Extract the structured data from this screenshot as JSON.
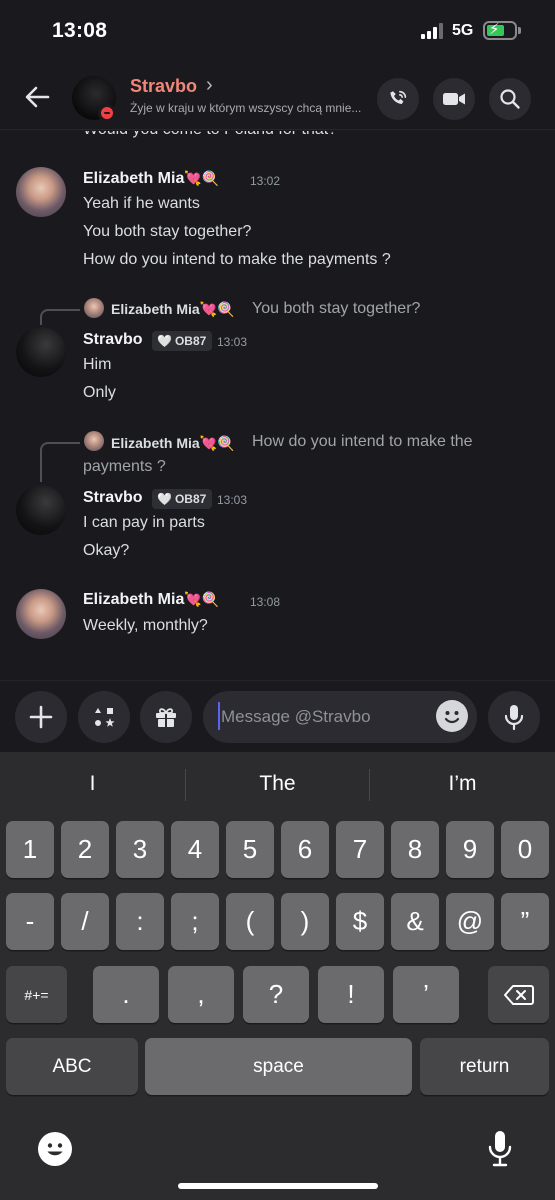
{
  "status_bar": {
    "time": "13:08",
    "network": "5G"
  },
  "header": {
    "name": "Stravbo",
    "status_text": "Żyje w kraju w którym wszyscy chcą mnie...",
    "icons": [
      "back-arrow-icon",
      "phone-icon",
      "video-camera-icon",
      "search-icon"
    ]
  },
  "messages": {
    "cutoff_text": "Would you come to Poland for that?",
    "groups": [
      {
        "author": "Elizabeth Mia",
        "author_emoji": "💘🍭",
        "time": "13:02",
        "lines": [
          "Yeah if he wants",
          "You both stay together?",
          "How do you intend to make the payments ?"
        ]
      },
      {
        "reply_to": {
          "author": "Elizabeth Mia",
          "author_emoji": "💘🍭",
          "text": "You both stay together?"
        },
        "author": "Stravbo",
        "tag": "OB87",
        "time": "13:03",
        "lines": [
          "Him",
          "Only"
        ]
      },
      {
        "reply_to": {
          "author": "Elizabeth Mia",
          "author_emoji": "💘🍭",
          "text_line1": "How do you intend to make the",
          "text_line2": "payments ?"
        },
        "author": "Stravbo",
        "tag": "OB87",
        "time": "13:03",
        "lines": [
          "I can pay in parts",
          "Okay?"
        ]
      },
      {
        "author": "Elizabeth Mia",
        "author_emoji": "💘🍭",
        "time": "13:08",
        "lines": [
          "Weekly, monthly?"
        ]
      }
    ]
  },
  "composer": {
    "placeholder": "Message @Stravbo",
    "icons": [
      "plus-icon",
      "apps-icon",
      "gift-icon",
      "emoji-icon",
      "microphone-icon"
    ]
  },
  "keyboard": {
    "suggestions": [
      "I",
      "The",
      "I’m"
    ],
    "row1": [
      "1",
      "2",
      "3",
      "4",
      "5",
      "6",
      "7",
      "8",
      "9",
      "0"
    ],
    "row2": [
      "-",
      "/",
      ":",
      ";",
      "(",
      ")",
      "$",
      "&",
      "@",
      "”"
    ],
    "row3": [
      "#+=",
      ".",
      ",",
      "?",
      "!",
      "’"
    ],
    "row4": [
      "ABC",
      "space",
      "return"
    ]
  }
}
